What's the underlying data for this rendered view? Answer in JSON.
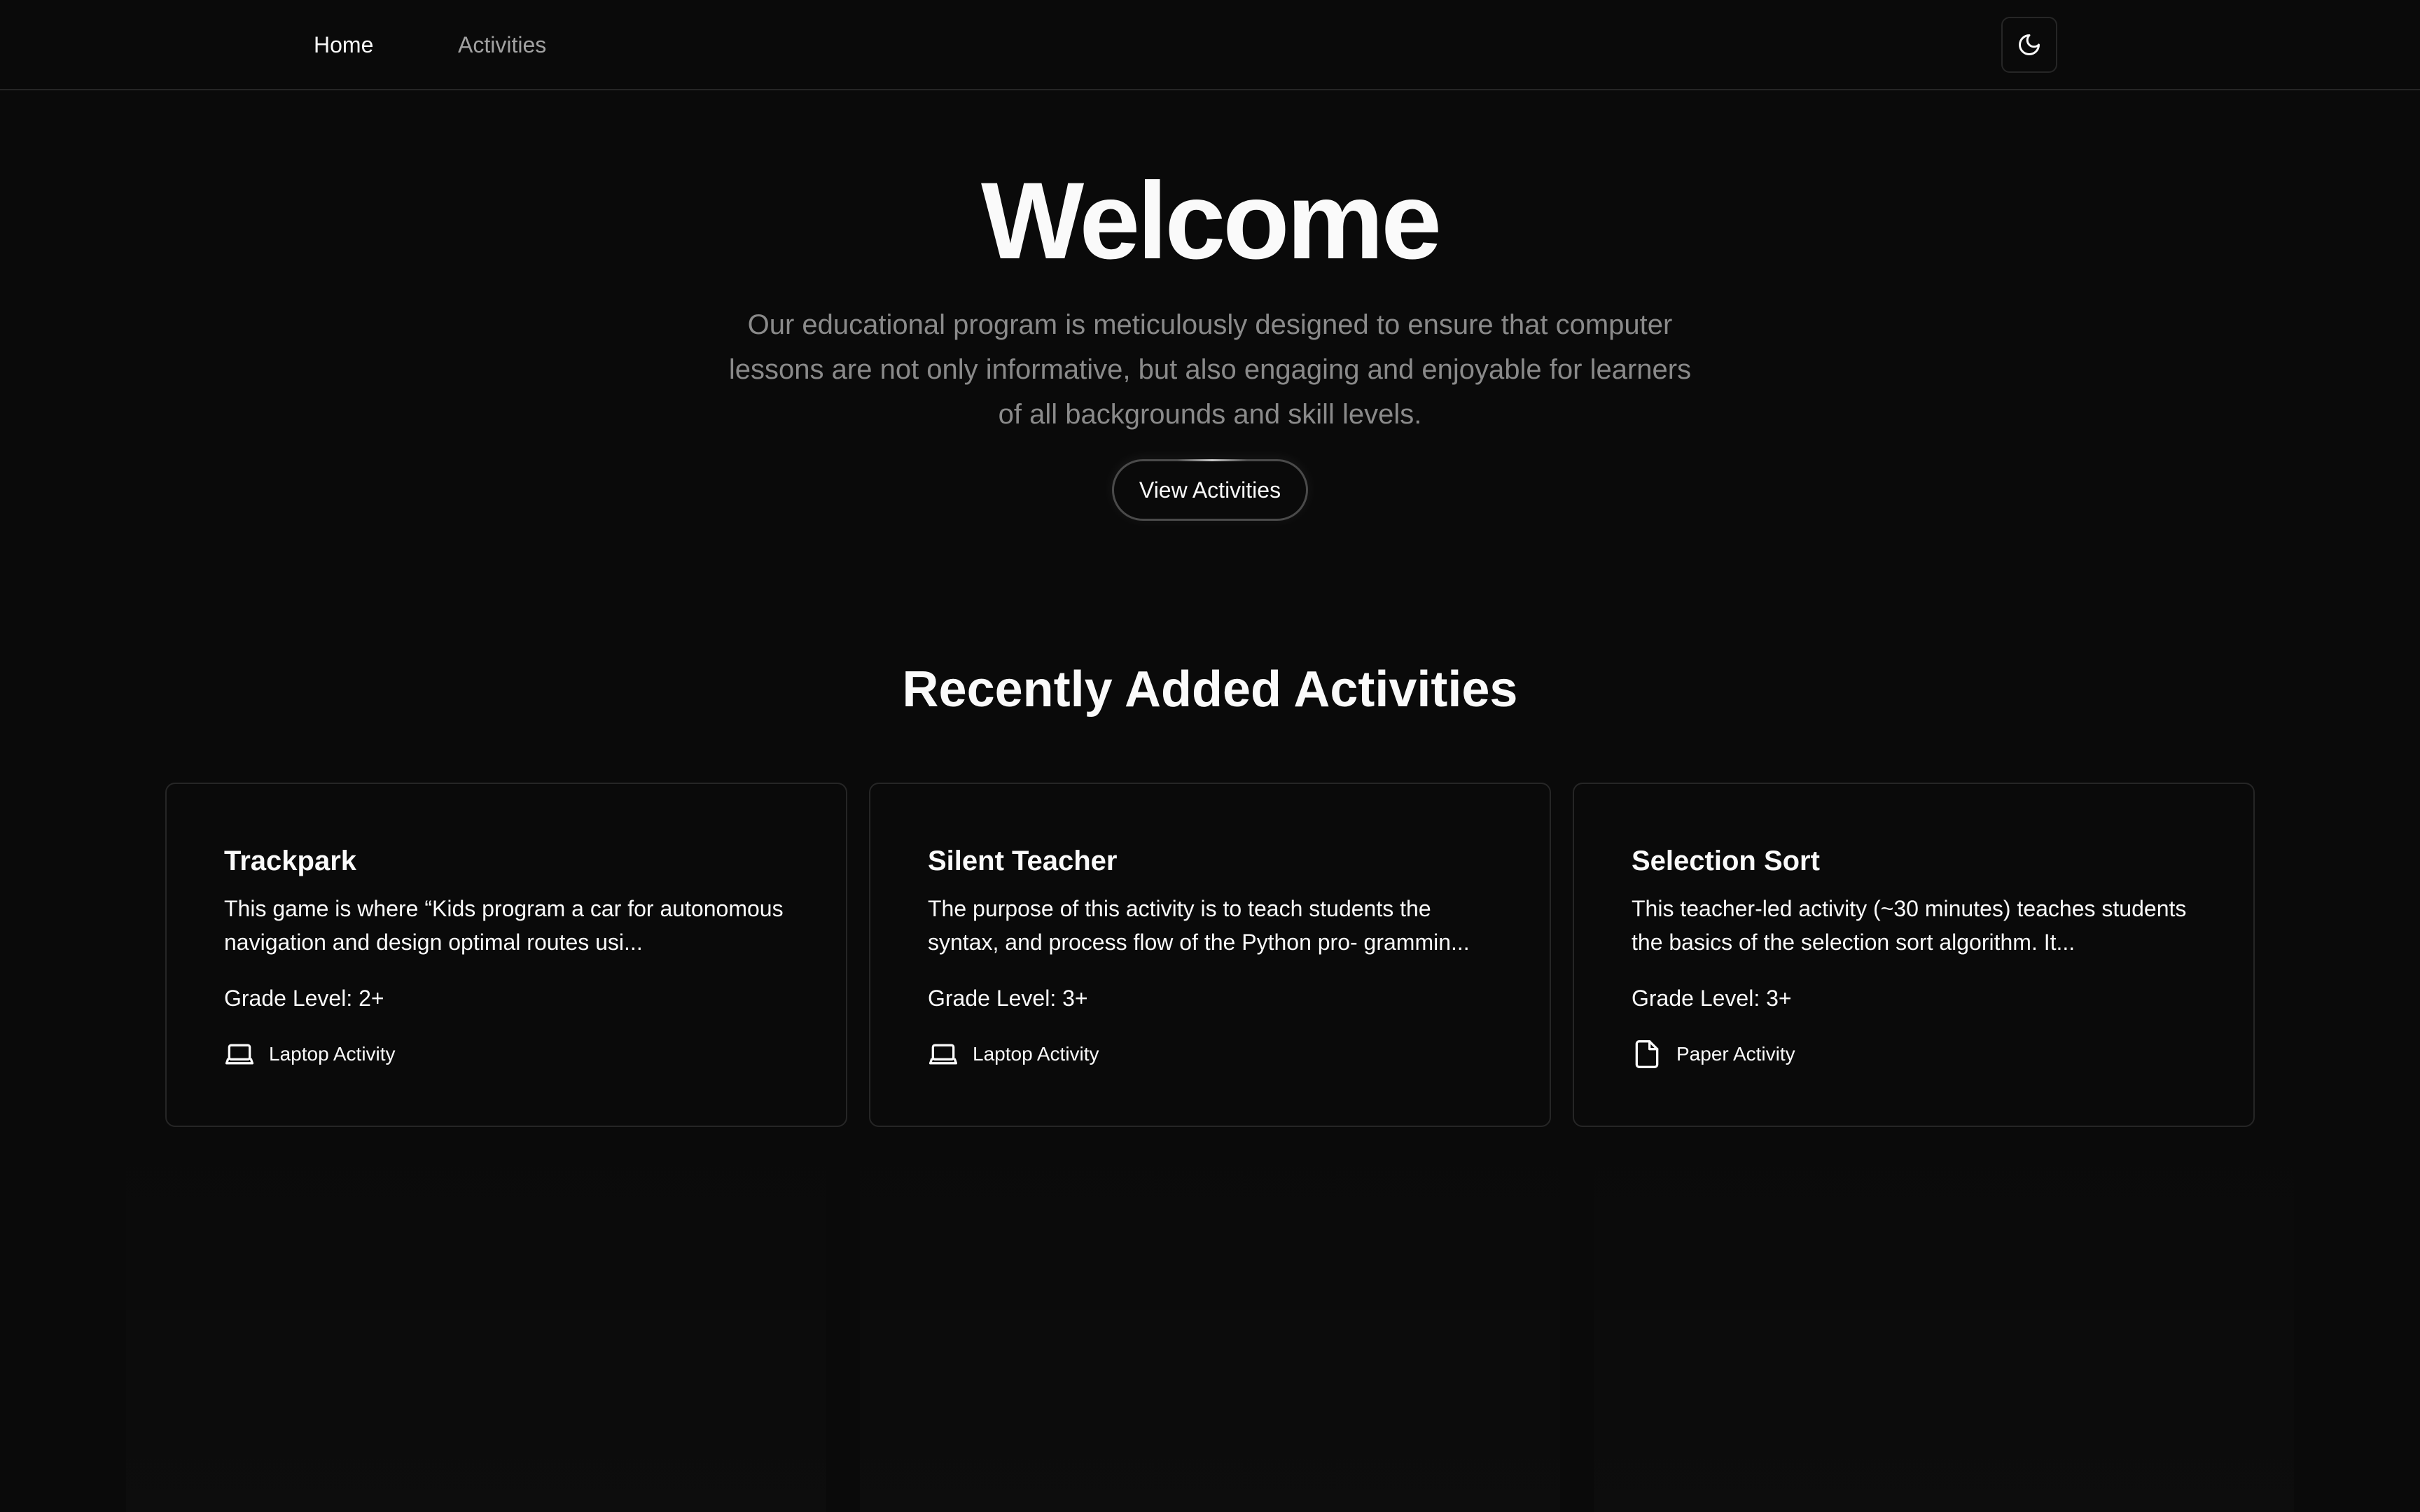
{
  "nav": {
    "home_label": "Home",
    "activities_label": "Activities",
    "theme_toggle_icon": "moon-icon"
  },
  "hero": {
    "title": "Welcome",
    "description": "Our educational program is meticulously designed to ensure that computer lessons are not only informative, but also engaging and enjoyable for learners of all backgrounds and skill levels.",
    "button_label": "View Activities"
  },
  "recent": {
    "title": "Recently Added Activities",
    "cards": [
      {
        "title": "Trackpark",
        "description": "This game is where “Kids program a car for autonomous navigation and design optimal routes usi...",
        "grade": "Grade Level: 2+",
        "type_label": "Laptop Activity",
        "type_icon": "laptop-icon"
      },
      {
        "title": "Silent Teacher",
        "description": "The purpose of this activity is to teach students the syntax, and process flow of the Python pro- grammin...",
        "grade": "Grade Level: 3+",
        "type_label": "Laptop Activity",
        "type_icon": "laptop-icon"
      },
      {
        "title": "Selection Sort",
        "description": "This teacher-led activity (~30 minutes) teaches students the basics of the selection sort algorithm. It...",
        "grade": "Grade Level: 3+",
        "type_label": "Paper Activity",
        "type_icon": "file-icon"
      }
    ]
  },
  "colors": {
    "background": "#0a0a0a",
    "foreground": "#fafafa",
    "muted": "#8a8a8a",
    "border": "#262626"
  }
}
